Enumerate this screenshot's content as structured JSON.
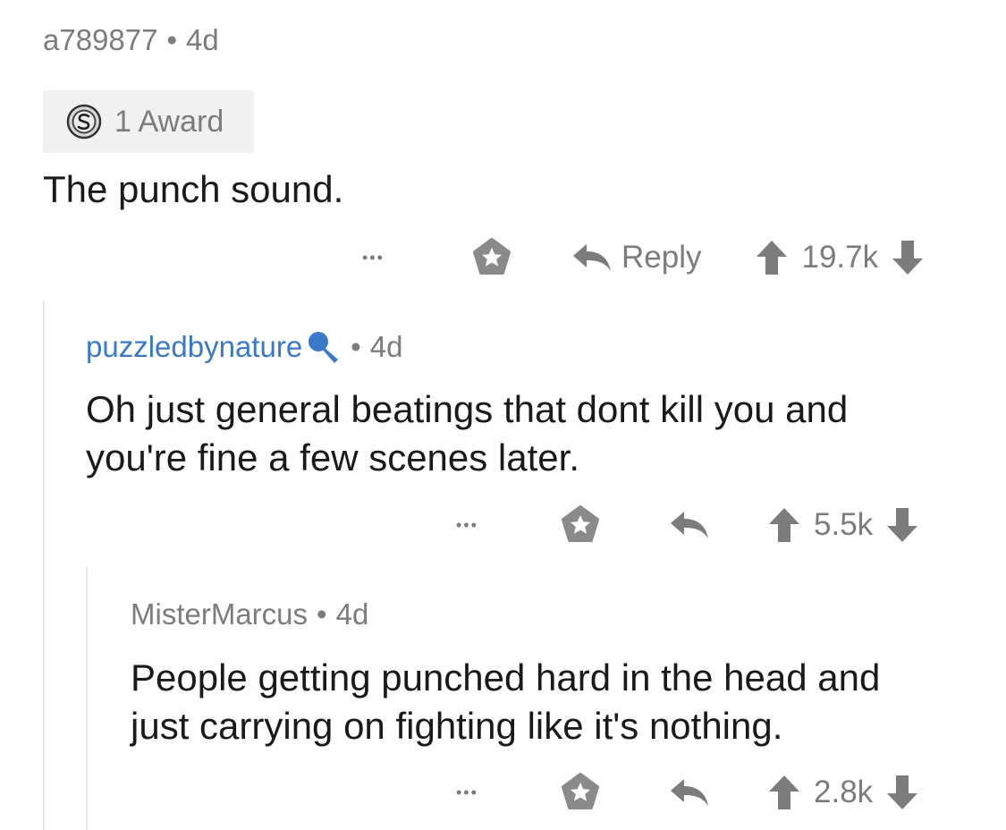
{
  "comments": [
    {
      "author": "a789877",
      "age": "4d",
      "award_label": "1 Award",
      "body": "The punch sound.",
      "more_label": "•••",
      "reply_label": "Reply",
      "score": "19.7k"
    },
    {
      "author": "puzzledbynature",
      "age": "4d",
      "body": "Oh just general beatings that dont kill you and\nyou're fine a few scenes later.",
      "more_label": "•••",
      "score": "5.5k"
    },
    {
      "author": "MisterMarcus",
      "age": "4d",
      "body": "People getting punched hard in the head and\njust carrying on fighting like it's nothing.",
      "more_label": "•••",
      "score": "2.8k"
    }
  ],
  "separator": "•",
  "colors": {
    "meta": "#7c7c7c",
    "link": "#3a78c9",
    "body": "#1a1a1b",
    "award_bg": "#f1f1f1",
    "thread_line": "#e6e6e6"
  },
  "icons": {
    "award": "silver-award-icon",
    "mod": "microphone-icon",
    "save": "star-badge-icon",
    "reply": "reply-arrow-icon",
    "upvote": "arrow-up-icon",
    "downvote": "arrow-down-icon"
  }
}
